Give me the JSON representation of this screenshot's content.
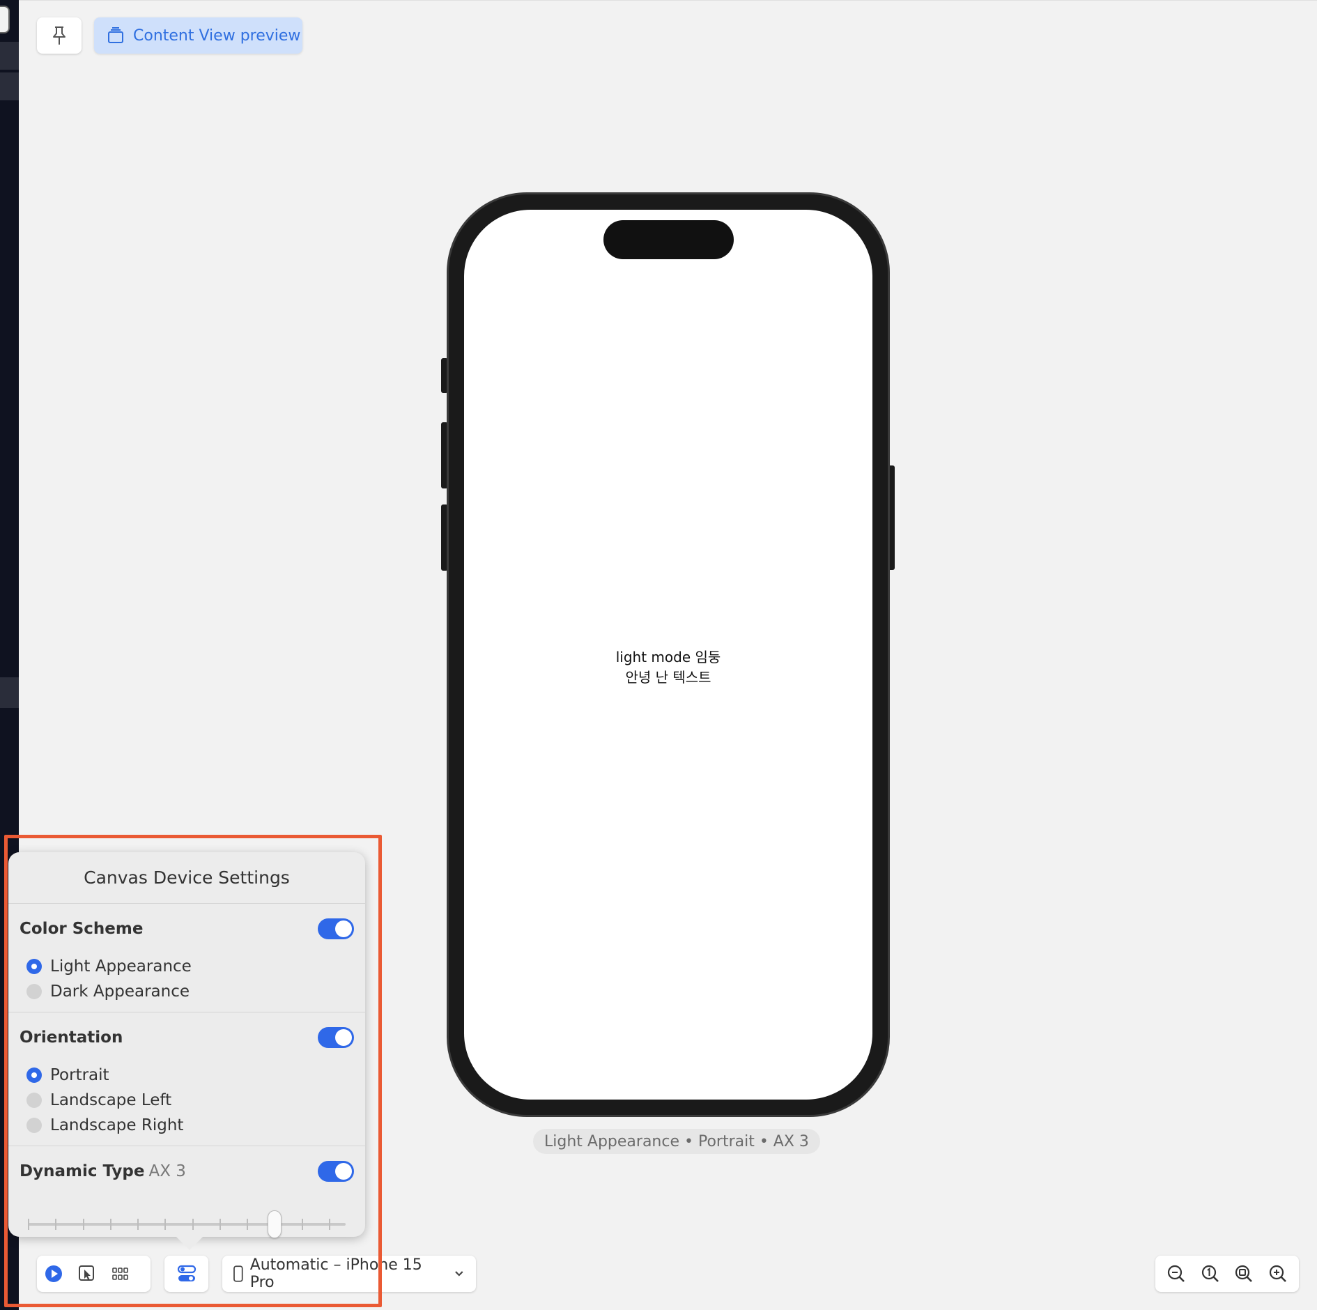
{
  "toolbar": {
    "preview_label": "Content View preview"
  },
  "phone": {
    "line1": "light mode 임둥",
    "line2": "안녕 난 텍스트"
  },
  "caption": "Light Appearance • Portrait • AX 3",
  "popover": {
    "title": "Canvas Device Settings",
    "color_scheme": {
      "label": "Color Scheme",
      "enabled": true,
      "options": [
        "Light Appearance",
        "Dark Appearance"
      ],
      "selected": "Light Appearance"
    },
    "orientation": {
      "label": "Orientation",
      "enabled": true,
      "options": [
        "Portrait",
        "Landscape Left",
        "Landscape Right"
      ],
      "selected": "Portrait"
    },
    "dynamic_type": {
      "label": "Dynamic Type",
      "value": "AX 3",
      "enabled": true,
      "steps": 12,
      "selected_step": 10
    }
  },
  "bottom_toolbar": {
    "device": "Automatic – iPhone 15 Pro"
  },
  "colors": {
    "accent": "#2f68e8",
    "annotation": "#ea5a34"
  }
}
